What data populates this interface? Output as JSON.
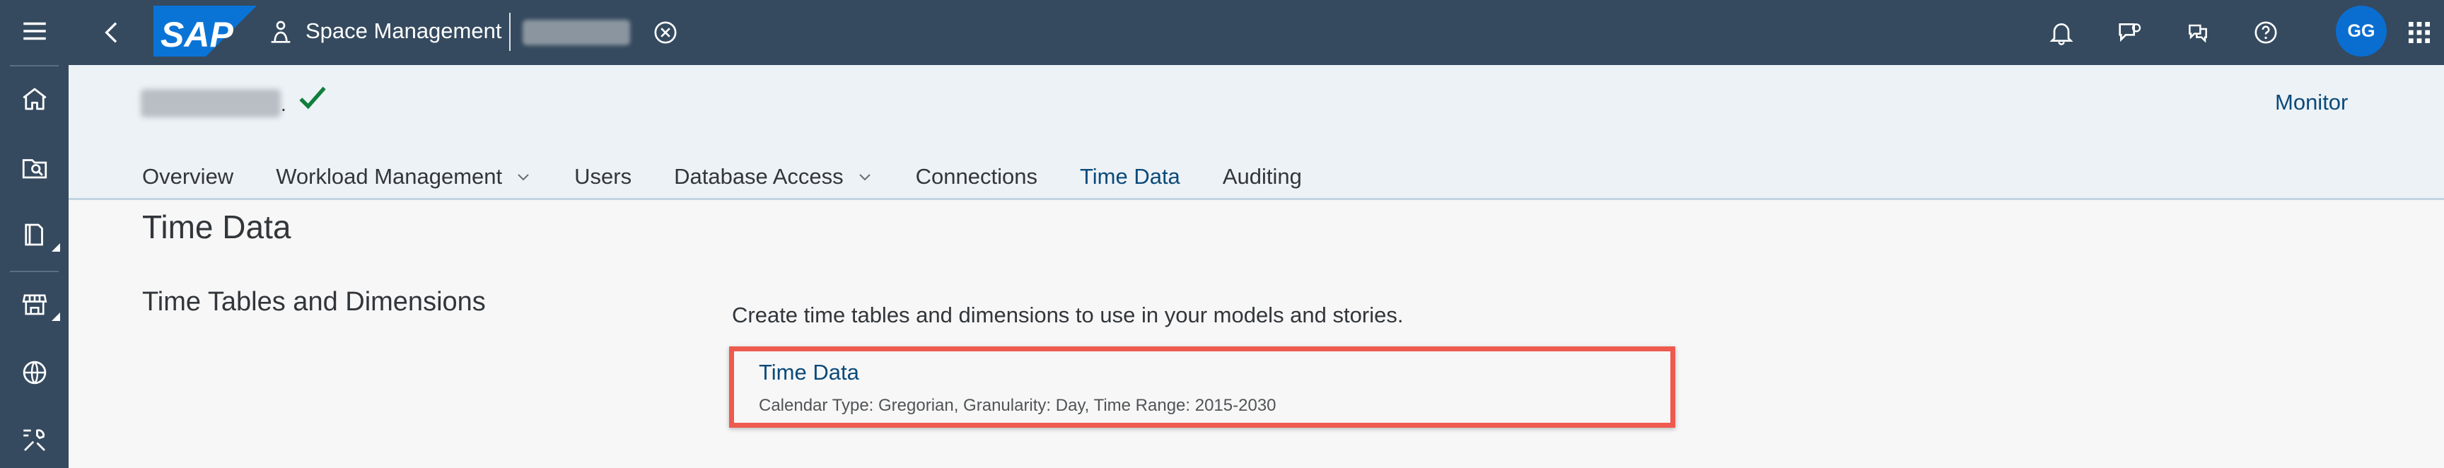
{
  "shell": {
    "app_title": "Space Management",
    "avatar_initials": "GG",
    "icons": [
      "menu-icon",
      "back-icon",
      "sap-logo",
      "space-management-icon",
      "close-circle-icon",
      "bell-icon",
      "feedback-icon",
      "help-chat-icon",
      "help-icon",
      "app-grid-icon"
    ]
  },
  "rail": {
    "items": [
      "home-icon",
      "search-document-icon",
      "files-icon",
      "marketplace-icon",
      "globe-icon",
      "tools-icon"
    ]
  },
  "object_header": {
    "name_suffix": ".",
    "monitor_label": "Monitor"
  },
  "tabs": [
    {
      "label": "Overview",
      "dropdown": false
    },
    {
      "label": "Workload Management",
      "dropdown": true
    },
    {
      "label": "Users",
      "dropdown": false
    },
    {
      "label": "Database Access",
      "dropdown": true
    },
    {
      "label": "Connections",
      "dropdown": false
    },
    {
      "label": "Time Data",
      "dropdown": false,
      "selected": true
    },
    {
      "label": "Auditing",
      "dropdown": false
    }
  ],
  "content": {
    "section_title": "Time Data",
    "subsection_title": "Time Tables and Dimensions",
    "description": "Create time tables and dimensions to use in your models and stories.",
    "card": {
      "link_label": "Time Data",
      "meta": "Calendar Type: Gregorian, Granularity: Day, Time Range: 2015-2030"
    }
  },
  "colors": {
    "shell_bg": "#354a5f",
    "link": "#0a4a7a",
    "avatar": "#0a6ed1",
    "highlight": "#ee5a4e",
    "success": "#107e3e"
  }
}
